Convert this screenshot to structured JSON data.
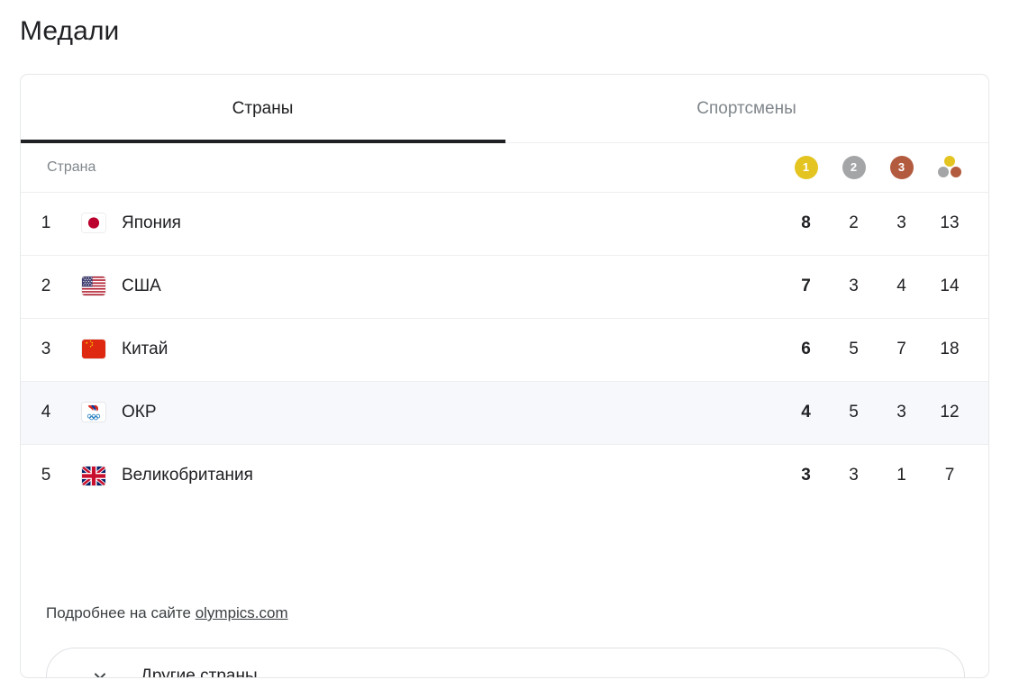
{
  "page_title": "Медали",
  "tabs": [
    {
      "label": "Страны",
      "active": true,
      "name": "tab-countries"
    },
    {
      "label": "Спортсмены",
      "active": false,
      "name": "tab-athletes"
    }
  ],
  "table": {
    "headers": {
      "country": "Страна",
      "gold": "1",
      "silver": "2",
      "bronze": "3",
      "total": "total-medals-icon"
    },
    "rows": [
      {
        "rank": "1",
        "flag": "jp",
        "country": "Япония",
        "gold": "8",
        "silver": "2",
        "bronze": "3",
        "total": "13",
        "highlight": false
      },
      {
        "rank": "2",
        "flag": "us",
        "country": "США",
        "gold": "7",
        "silver": "3",
        "bronze": "4",
        "total": "14",
        "highlight": false
      },
      {
        "rank": "3",
        "flag": "cn",
        "country": "Китай",
        "gold": "6",
        "silver": "5",
        "bronze": "7",
        "total": "18",
        "highlight": false
      },
      {
        "rank": "4",
        "flag": "roc",
        "country": "ОКР",
        "gold": "4",
        "silver": "5",
        "bronze": "3",
        "total": "12",
        "highlight": true
      },
      {
        "rank": "5",
        "flag": "gb",
        "country": "Великобритания",
        "gold": "3",
        "silver": "3",
        "bronze": "1",
        "total": "7",
        "highlight": false
      }
    ]
  },
  "footer": {
    "more_prefix": "Подробнее на сайте ",
    "more_link_text": "olympics.com"
  },
  "expand": {
    "label": "Другие страны",
    "icon": "chevron-down-icon"
  },
  "colors": {
    "gold": "#e4c421",
    "silver": "#a3a5a7",
    "bronze": "#b35b3f",
    "text": "#202124",
    "muted": "#80868b",
    "highlight_row": "#f6f8fb",
    "border": "#eceef0"
  }
}
